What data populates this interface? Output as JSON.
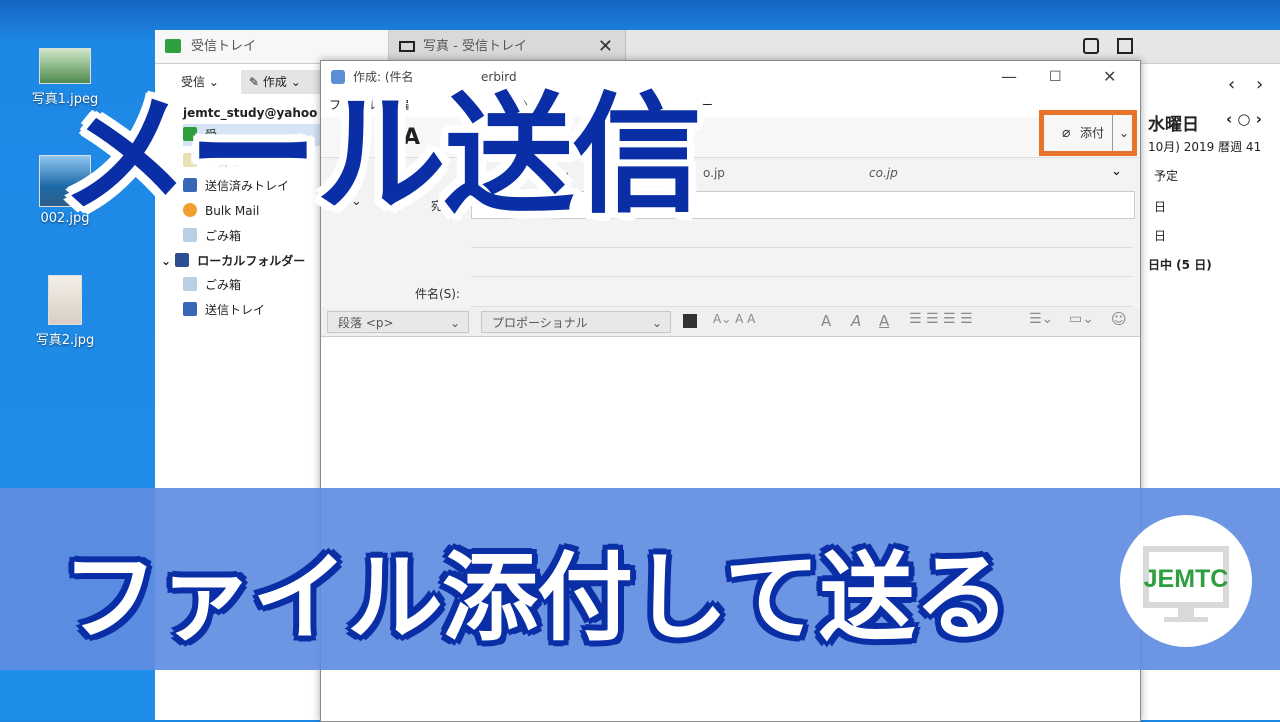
{
  "overlay": {
    "title": "メール送信",
    "subtitle": "ファイル添付して送る",
    "logo": "JEMTC"
  },
  "desktop": {
    "icons": [
      {
        "label": "写真1.jpeg"
      },
      {
        "label": "002.jpg"
      },
      {
        "label": "写真2.jpg"
      }
    ]
  },
  "thunderbird": {
    "tabs": [
      {
        "label": "受信トレイ"
      },
      {
        "label": "写真 - 受信トレイ"
      }
    ],
    "toolbar": {
      "receive": "受信",
      "compose": "作成"
    },
    "account": "jemtc_study@yahoo",
    "folders": [
      {
        "label": "受",
        "icon": "inbox-icon"
      },
      {
        "label": "下書き",
        "icon": "drafts-icon"
      },
      {
        "label": "送信済みトレイ",
        "icon": "sent-icon"
      },
      {
        "label": "Bulk Mail",
        "icon": "bulk-icon"
      },
      {
        "label": "ごみ箱",
        "icon": "trash-icon"
      }
    ],
    "local_folders": "ローカルフォルダー",
    "local_items": [
      {
        "label": "ごみ箱",
        "icon": "trash-icon"
      },
      {
        "label": "送信トレイ",
        "icon": "outbox-icon"
      }
    ],
    "calendar": {
      "day": "水曜日",
      "date_line": "10月) 2019 暦週 41",
      "upcoming": "予定",
      "item1": "日",
      "item2": "日",
      "item3": "日中 (5 日)"
    }
  },
  "compose": {
    "title": "作成: (件名",
    "title_right": "erbird",
    "menu": [
      "ファイル(F)",
      "編",
      "挿入(I)",
      "ー"
    ],
    "from_partial": "レッスン",
    "from_domain_1": "o.jp",
    "from_domain_2": "co.jp",
    "to_label": "宛先",
    "subject_label": "件名(S):",
    "paragraph_select": "段落 <p>",
    "font_select": "プロポーショナル",
    "attach_label": "添付"
  },
  "colors": {
    "title_blue": "#0a2ea5",
    "banner": "#5f8ce1",
    "highlight": "#e8742b",
    "logo_green": "#2e9e3e"
  }
}
